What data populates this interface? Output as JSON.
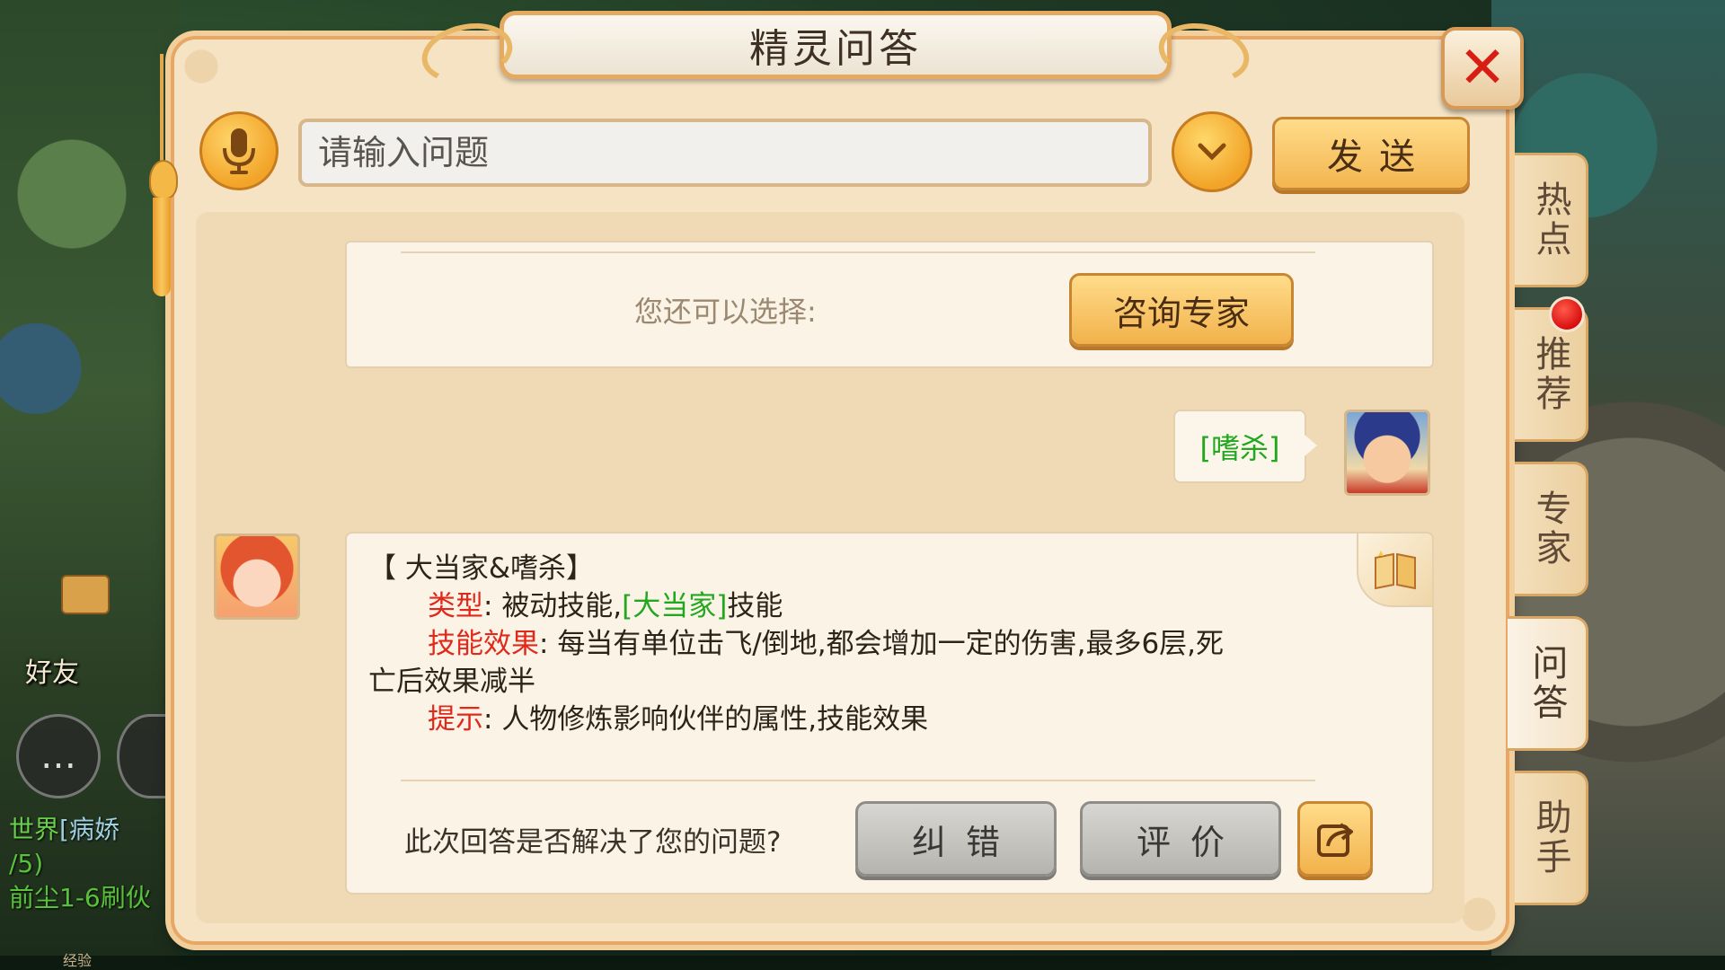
{
  "dialog": {
    "title": "精灵问答",
    "close_glyph": "✕"
  },
  "input": {
    "placeholder": "请输入问题",
    "value": "",
    "send_label": "发送"
  },
  "expert": {
    "prompt": "您还可以选择:",
    "consult_label": "咨询专家"
  },
  "user_message": {
    "text": "[嗜杀]"
  },
  "answer": {
    "heading": "【 大当家&嗜杀】",
    "type_label": "类型",
    "type_sep": ":",
    "type_text": "被动技能,",
    "type_link": "[大当家]",
    "type_suffix": "技能",
    "effect_label": "技能效果",
    "effect_sep": ":",
    "effect_text": "每当有单位击飞/倒地,都会增加一定的伤害,最多6层,死",
    "effect_text_2": "亡后效果减半",
    "tip_label": "提示",
    "tip_sep": ":",
    "tip_text": "人物修炼影响伙伴的属性,技能效果",
    "highlight_color": "#e0291b",
    "link_color": "#21a81e"
  },
  "feedback": {
    "question": "此次回答是否解决了您的问题?",
    "correct_label": "纠错",
    "rate_label": "评价"
  },
  "side_tabs": [
    {
      "label": "热点",
      "active": false
    },
    {
      "label": "推荐",
      "active": false,
      "badge": true
    },
    {
      "label": "专家",
      "active": false
    },
    {
      "label": "问答",
      "active": true
    },
    {
      "label": "助手",
      "active": false
    }
  ],
  "background_hud": {
    "friends_label": "好友",
    "chat_channel": "世界",
    "chat_line_1": "[病娇",
    "chat_line_2": "/5)",
    "chat_line_3": "前尘1-6刷伙",
    "exp_label": "经验"
  },
  "icons": {
    "mic": "microphone-icon",
    "dropdown": "chevron-down-icon",
    "close": "close-icon",
    "book": "book-icon",
    "share": "share-icon"
  }
}
